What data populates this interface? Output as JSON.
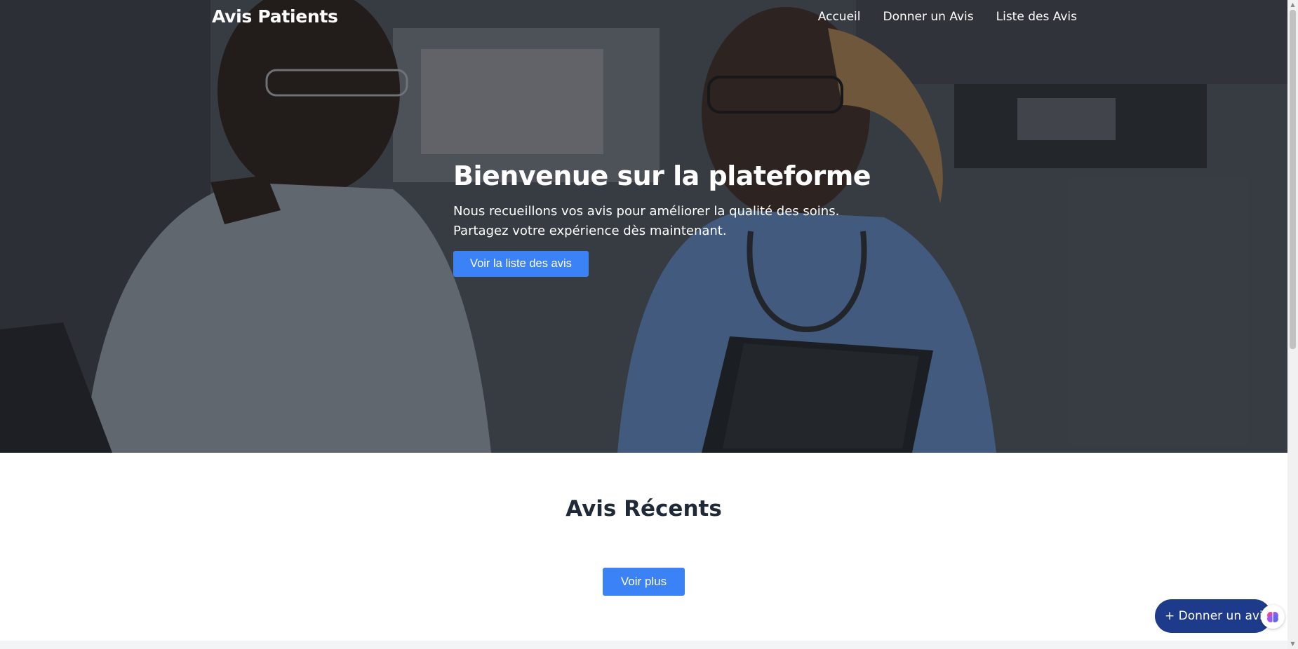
{
  "header": {
    "brand": "Avis Patients",
    "nav": [
      {
        "label": "Accueil"
      },
      {
        "label": "Donner un Avis"
      },
      {
        "label": "Liste des Avis"
      }
    ]
  },
  "hero": {
    "title": "Bienvenue sur la plateforme",
    "subtitle_line1": "Nous recueillons vos avis pour améliorer la qualité des soins.",
    "subtitle_line2": "Partagez votre expérience dès maintenant.",
    "cta_label": "Voir la liste des avis"
  },
  "recent": {
    "title": "Avis Récents",
    "more_label": "Voir plus"
  },
  "fab": {
    "label": "+ Donner un avis"
  },
  "colors": {
    "accent": "#3b82f6",
    "fab": "#1e3a8a"
  }
}
